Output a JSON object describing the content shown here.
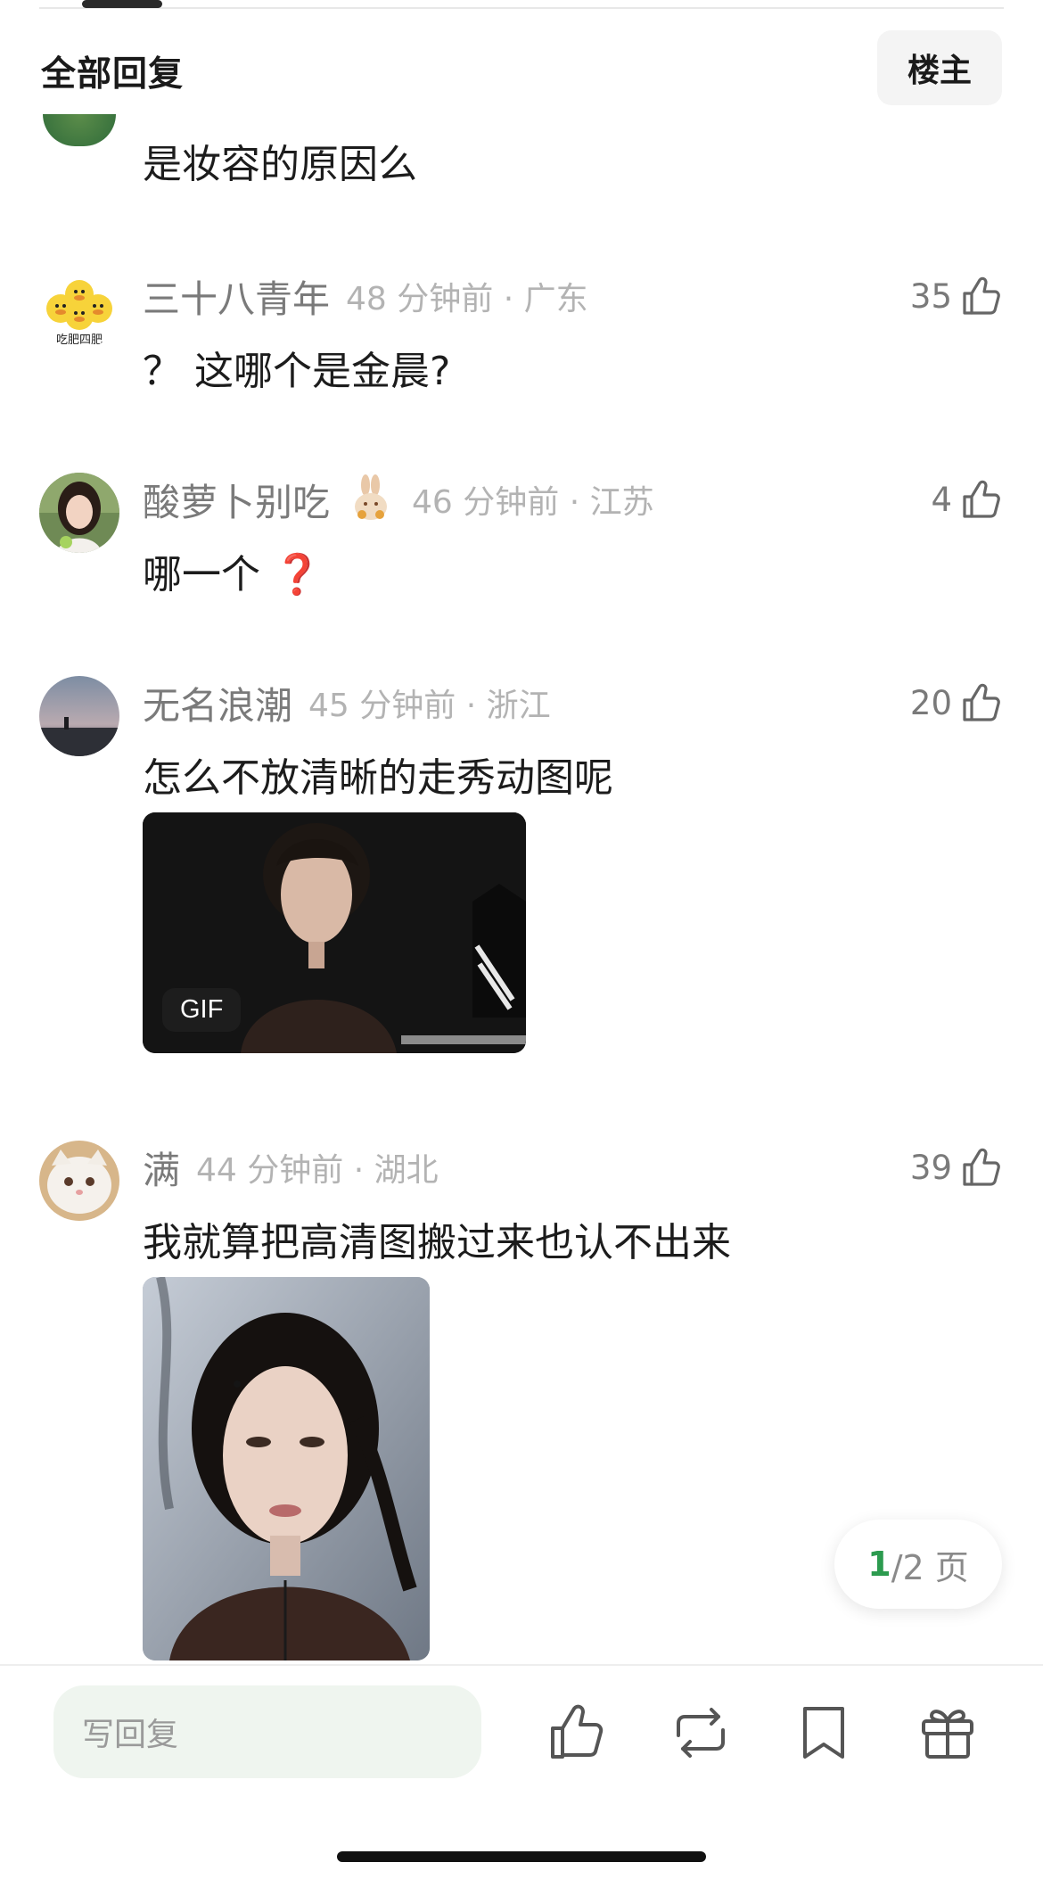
{
  "header": {
    "title": "全部回复",
    "owner_button": "楼主"
  },
  "first_comment": {
    "text": "是妆容的原因么"
  },
  "comments": [
    {
      "name": "三十八青年",
      "time_location": "48 分钟前 · 广东",
      "text": "？ 这哪个是金晨?",
      "likes": "35",
      "avatar_caption": "吃肥四肥"
    },
    {
      "name": "酸萝卜别吃",
      "time_location": "46 分钟前 · 江苏",
      "text": "哪一个",
      "text_suffix": "❓",
      "likes": "4"
    },
    {
      "name": "无名浪潮",
      "time_location": "45 分钟前 · 浙江",
      "text": "怎么不放清晰的走秀动图呢",
      "likes": "20",
      "image_badge": "GIF"
    },
    {
      "name": "满",
      "time_location": "44 分钟前 · 湖北",
      "text": "我就算把高清图搬过来也认不出来",
      "likes": "39"
    }
  ],
  "pagination": {
    "current": "1",
    "total": "/2 页"
  },
  "bottom_bar": {
    "reply_placeholder": "写回复"
  },
  "colors": {
    "accent_green": "#2c9b4f",
    "meta_gray": "#b3b3b3",
    "name_gray": "#7a7a7a",
    "question_red": "#d81e1e"
  }
}
